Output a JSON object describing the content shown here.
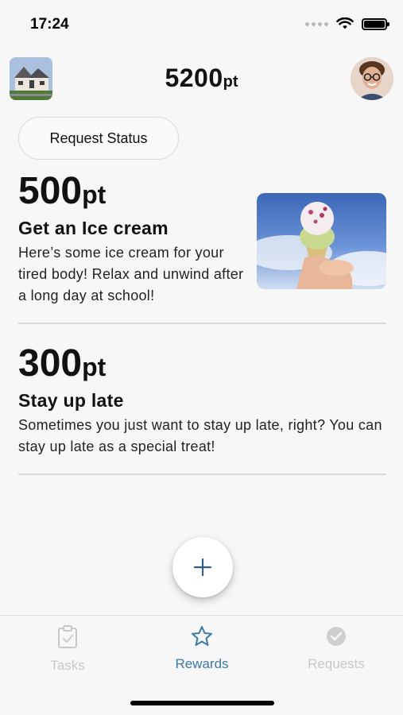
{
  "status_bar": {
    "time": "17:24"
  },
  "header": {
    "points_value": "5200",
    "points_unit": "pt"
  },
  "request_status_label": "Request Status",
  "rewards": [
    {
      "points": "500",
      "unit": "pt",
      "title": "Get an Ice cream",
      "description": "Here’s some ice cream for your tired body! Relax and unwind after a long day at school!"
    },
    {
      "points": "300",
      "unit": "pt",
      "title": "Stay up late",
      "description": "Sometimes you just want to stay up late, right? You can stay up late as a special treat!"
    }
  ],
  "fab": {
    "icon": "plus-icon"
  },
  "tabs": [
    {
      "label": "Tasks",
      "icon": "clipboard-check-icon",
      "active": false
    },
    {
      "label": "Rewards",
      "icon": "star-icon",
      "active": true
    },
    {
      "label": "Requests",
      "icon": "chat-check-icon",
      "active": false
    }
  ],
  "colors": {
    "accent": "#3b79a8",
    "inactive": "#c8c8c8",
    "background": "#f7f7f7"
  }
}
